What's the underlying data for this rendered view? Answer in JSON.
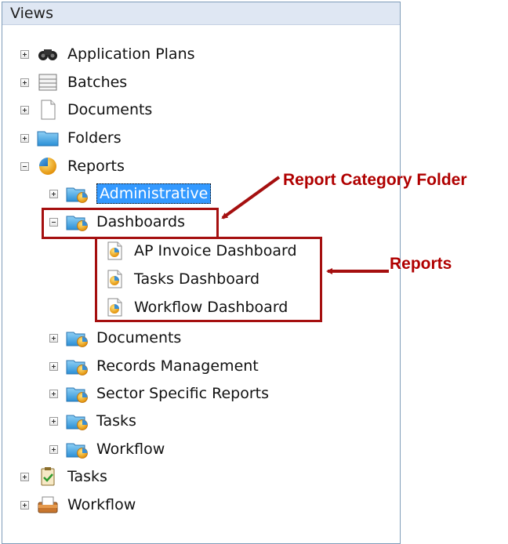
{
  "panel": {
    "title": "Views"
  },
  "tree": {
    "application_plans": "Application Plans",
    "batches": "Batches",
    "documents": "Documents",
    "folders": "Folders",
    "reports": "Reports",
    "reports_children": {
      "administrative": "Administrative",
      "dashboards": "Dashboards",
      "dashboards_children": [
        "AP Invoice Dashboard",
        "Tasks Dashboard",
        "Workflow Dashboard"
      ],
      "documents": "Documents",
      "records_management": "Records Management",
      "sector_specific_reports": "Sector Specific Reports",
      "tasks": "Tasks",
      "workflow": "Workflow"
    },
    "tasks": "Tasks",
    "workflow": "Workflow"
  },
  "annotations": {
    "category_folder": "Report Category Folder",
    "reports": "Reports",
    "color": "#a50f0f"
  }
}
